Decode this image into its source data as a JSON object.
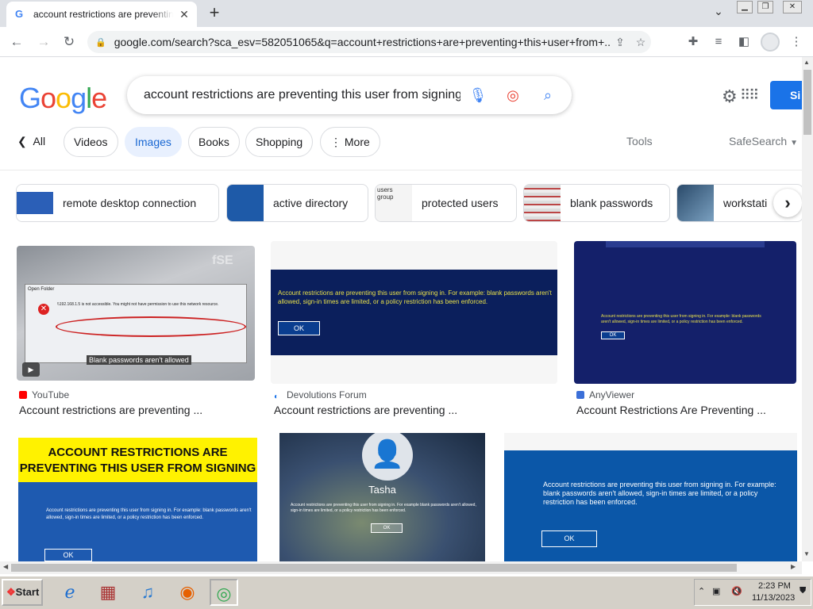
{
  "browser": {
    "tab_title": "account restrictions are preventing this",
    "tab_favicon": "G",
    "new_tab": "+",
    "url": "google.com/search?sca_esv=582051065&q=account+restrictions+are+preventing+this+user+from+..."
  },
  "search": {
    "logo": "Google",
    "query": "account restrictions are preventing this user from signing",
    "signin_label": "Si"
  },
  "filters": {
    "all": "All",
    "chips": [
      "Videos",
      "Images",
      "Books",
      "Shopping",
      "More"
    ],
    "active": "Images",
    "tools": "Tools",
    "safesearch": "SafeSearch"
  },
  "related": [
    {
      "label": "remote desktop connection"
    },
    {
      "label": "active directory"
    },
    {
      "label": "protected users"
    },
    {
      "label": "blank passwords"
    },
    {
      "label": "workstati"
    }
  ],
  "related_thumb_text": {
    "protected": "users group"
  },
  "results": [
    {
      "source": "YouTube",
      "title": "Account restrictions are preventing ...",
      "caption": "Blank passwords aren't allowed",
      "dialog_title": "Open Folder",
      "dialog_path": "\\\\192.168.1.5 is not accessible. You might not have permission to use this network resource.",
      "watermark": "fSE"
    },
    {
      "source": "Devolutions Forum",
      "title": "Account restrictions are preventing ...",
      "message": "Account restrictions are preventing this user from signing in. For example: blank passwords aren't allowed, sign-in times are limited, or a policy restriction has been enforced.",
      "ok": "OK"
    },
    {
      "source": "AnyViewer",
      "title": "Account Restrictions Are Preventing ...",
      "message": "Account restrictions are preventing this user from signing in. For example: blank passwords aren't allowed, sign-in times are limited, or a policy restriction has been enforced.",
      "ok": "OK"
    },
    {
      "banner": "ACCOUNT RESTRICTIONS ARE PREVENTING THIS USER FROM SIGNING",
      "message": "Account restrictions are preventing this user from signing in. For example: blank passwords aren't allowed, sign-in times are limited, or a policy restriction has been enforced.",
      "ok": "OK"
    },
    {
      "user": "Tasha",
      "message": "Account restrictions are preventing this user from signing in. For example blank passwords aren't allowed, sign-in times are limited, or a policy restriction has been enforced.",
      "ok": "OK"
    },
    {
      "message": "Account restrictions are preventing this user from signing in. For example: blank passwords aren't allowed, sign-in times are limited, or a policy restriction has been enforced.",
      "ok": "OK"
    }
  ],
  "taskbar": {
    "start": "Start",
    "time": "2:23 PM",
    "date": "11/13/2023"
  },
  "colors": {
    "accent": "#1a73e8",
    "chip_active_bg": "#e8f0fe",
    "error_blue": "#0b1f5c"
  }
}
